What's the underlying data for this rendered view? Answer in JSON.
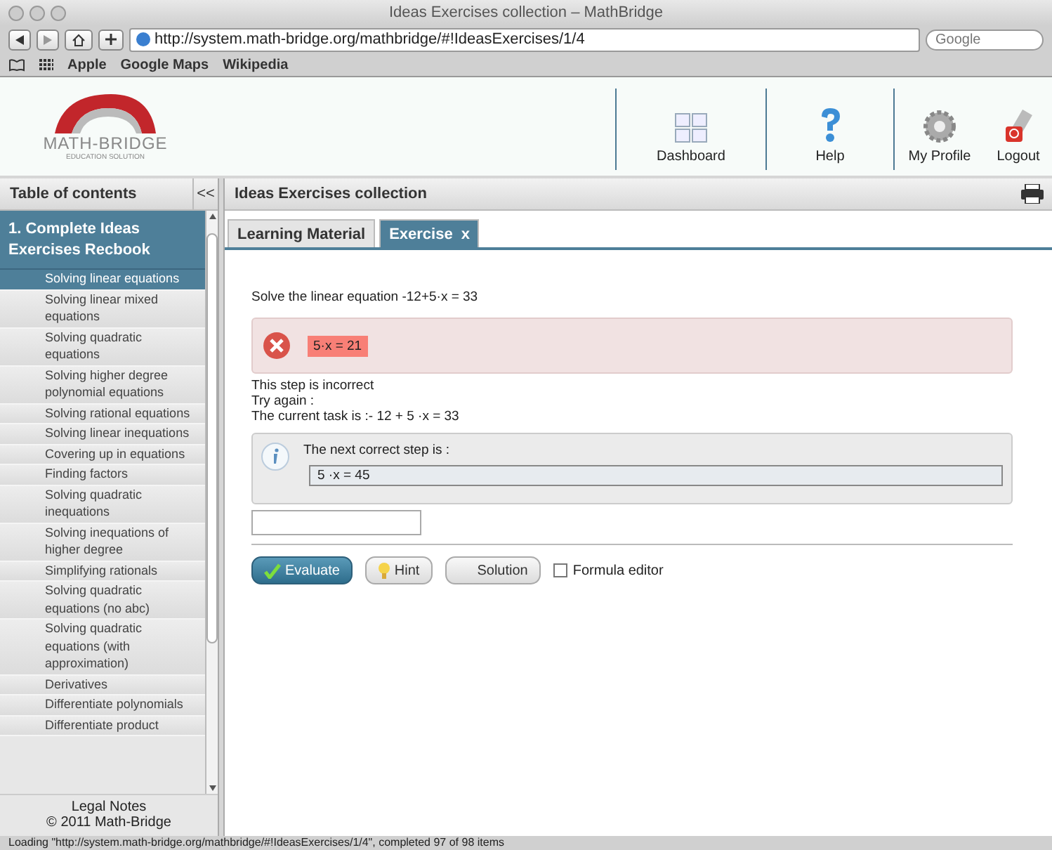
{
  "window": {
    "title": "Ideas Exercises collection – MathBridge"
  },
  "browser": {
    "url": "http://system.math-bridge.org/mathbridge/#!IdeasExercises/1/4",
    "search_placeholder": "Google",
    "bookmarks": [
      "Apple",
      "Google Maps",
      "Wikipedia"
    ]
  },
  "header": {
    "logo_name": "MATH-BRIDGE",
    "logo_tagline": "EDUCATION SOLUTION",
    "nav": [
      {
        "kind": "dashboard",
        "label": "Dashboard"
      },
      {
        "kind": "help",
        "label": "Help"
      },
      {
        "kind": "profile",
        "label": "My Profile"
      },
      {
        "kind": "logout",
        "label": "Logout"
      }
    ]
  },
  "sidebar": {
    "title": "Table of contents",
    "collapse": "<<",
    "section": "1. Complete Ideas Exercises Recbook",
    "items": [
      {
        "label": "Solving linear equations",
        "selected": true
      },
      {
        "label": "Solving linear mixed equations",
        "selected": false
      },
      {
        "label": "Solving quadratic equations",
        "selected": false
      },
      {
        "label": "Solving higher degree polynomial equations",
        "selected": false
      },
      {
        "label": "Solving rational equations",
        "selected": false
      },
      {
        "label": "Solving linear inequations",
        "selected": false
      },
      {
        "label": "Covering up in equations",
        "selected": false
      },
      {
        "label": "Finding factors",
        "selected": false
      },
      {
        "label": "Solving quadratic inequations",
        "selected": false
      },
      {
        "label": "Solving inequations of higher degree",
        "selected": false
      },
      {
        "label": "Simplifying rationals",
        "selected": false
      },
      {
        "label": "Solving quadratic equations (no abc)",
        "selected": false
      },
      {
        "label": "Solving quadratic equations (with approximation)",
        "selected": false
      },
      {
        "label": "Derivatives",
        "selected": false
      },
      {
        "label": "Differentiate polynomials",
        "selected": false
      },
      {
        "label": "Differentiate product",
        "selected": false
      }
    ],
    "footer": [
      "Legal Notes",
      "© 2011 Math-Bridge"
    ]
  },
  "main": {
    "title": "Ideas Exercises collection",
    "tabs": [
      {
        "label": "Learning Material",
        "selected": false
      },
      {
        "label": "Exercise",
        "selected": true,
        "close": "x"
      }
    ],
    "question": "Solve the linear equation -12+5·x = 33",
    "wrong_answer": "5·x = 21",
    "feedback": [
      "This step is incorrect",
      "Try again :",
      "The current task is :- 12 + 5 ·x =  33"
    ],
    "hint_title": "The next correct step is :",
    "hint_value": "5 ·x =  45",
    "buttons": [
      {
        "kind": "evaluate",
        "label": "Evaluate"
      },
      {
        "kind": "hint",
        "label": "Hint"
      },
      {
        "kind": "solution",
        "label": "Solution"
      }
    ],
    "formula_editor": {
      "label": "Formula editor",
      "checked": false
    }
  },
  "status_bar": "Loading \"http://system.math-bridge.org/mathbridge/#!IdeasExercises/1/4\", completed 97 of 98 items"
}
